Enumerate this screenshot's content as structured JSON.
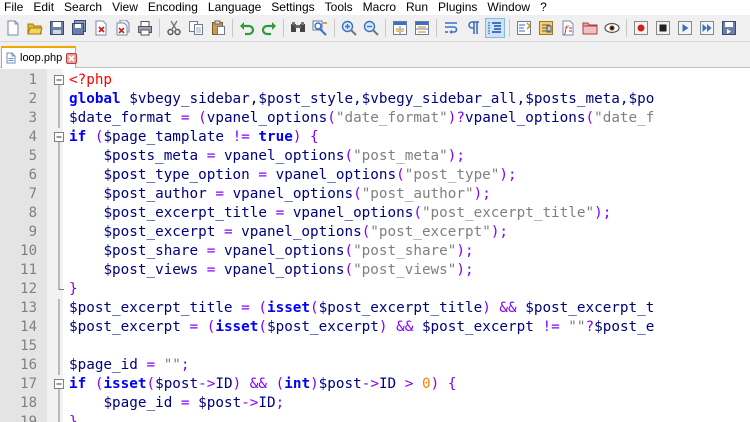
{
  "menu": [
    "File",
    "Edit",
    "Search",
    "View",
    "Encoding",
    "Language",
    "Settings",
    "Tools",
    "Macro",
    "Run",
    "Plugins",
    "Window",
    "?"
  ],
  "toolbar": {
    "groups": [
      [
        "new-file-icon",
        "open-file-icon",
        "save-icon",
        "save-all-icon",
        "close-icon",
        "close-all-icon",
        "print-icon"
      ],
      [
        "cut-icon",
        "copy-icon",
        "paste-icon"
      ],
      [
        "undo-icon",
        "redo-icon"
      ],
      [
        "find-icon",
        "replace-icon"
      ],
      [
        "zoom-in-icon",
        "zoom-out-icon"
      ],
      [
        "sync-vertical-icon",
        "sync-horizontal-icon"
      ],
      [
        "word-wrap-icon",
        "show-all-characters-icon",
        "indent-guide-icon"
      ],
      [
        "define-language-icon",
        "document-map-icon",
        "function-list-icon",
        "folder-workspace-icon",
        "monitoring-icon"
      ],
      [
        "record-macro-icon",
        "stop-recording-icon",
        "playback-macro-icon",
        "run-macro-multiple-icon",
        "save-macro-icon"
      ]
    ],
    "active": "indent-guide-icon",
    "colors": {
      "accent_blue": "#3c6fc4",
      "accent_red": "#cc2222",
      "accent_green": "#2e9a3e",
      "folder": "#e8b830"
    }
  },
  "tab": {
    "label": "loop.php",
    "accent": "#f0a800"
  },
  "editor": {
    "lines": [
      {
        "n": "1",
        "fold": "minus",
        "tokens": [
          [
            "tag",
            "<?php"
          ]
        ]
      },
      {
        "n": "2",
        "fold": "line",
        "tokens": [
          [
            "kw",
            "global"
          ],
          [
            "plain",
            " $vbegy_sidebar,$post_style,$vbegy_sidebar_all,$posts_meta,$po"
          ]
        ]
      },
      {
        "n": "3",
        "fold": "line",
        "tokens": [
          [
            "var",
            "$date_format"
          ],
          [
            "plain",
            " "
          ],
          [
            "op",
            "="
          ],
          [
            "plain",
            " "
          ],
          [
            "op",
            "("
          ],
          [
            "fn",
            "vpanel_options"
          ],
          [
            "op",
            "("
          ],
          [
            "str",
            "\"date_format\""
          ],
          [
            "op",
            ")?"
          ],
          [
            "fn",
            "vpanel_options"
          ],
          [
            "op",
            "("
          ],
          [
            "str",
            "\"date_f"
          ]
        ]
      },
      {
        "n": "4",
        "fold": "minus",
        "tokens": [
          [
            "kw",
            "if"
          ],
          [
            "plain",
            " "
          ],
          [
            "op",
            "("
          ],
          [
            "var",
            "$page_tamplate"
          ],
          [
            "plain",
            " "
          ],
          [
            "op",
            "!="
          ],
          [
            "plain",
            " "
          ],
          [
            "kw",
            "true"
          ],
          [
            "op",
            ")"
          ],
          [
            "plain",
            " "
          ],
          [
            "op",
            "{"
          ]
        ]
      },
      {
        "n": "5",
        "fold": "line",
        "tokens": [
          [
            "plain",
            "    "
          ],
          [
            "var",
            "$posts_meta"
          ],
          [
            "plain",
            " "
          ],
          [
            "op",
            "="
          ],
          [
            "plain",
            " "
          ],
          [
            "fn",
            "vpanel_options"
          ],
          [
            "op",
            "("
          ],
          [
            "str",
            "\"post_meta\""
          ],
          [
            "op",
            ");"
          ]
        ]
      },
      {
        "n": "6",
        "fold": "line",
        "tokens": [
          [
            "plain",
            "    "
          ],
          [
            "var",
            "$post_type_option"
          ],
          [
            "plain",
            " "
          ],
          [
            "op",
            "="
          ],
          [
            "plain",
            " "
          ],
          [
            "fn",
            "vpanel_options"
          ],
          [
            "op",
            "("
          ],
          [
            "str",
            "\"post_type\""
          ],
          [
            "op",
            ");"
          ]
        ]
      },
      {
        "n": "7",
        "fold": "line",
        "tokens": [
          [
            "plain",
            "    "
          ],
          [
            "var",
            "$post_author"
          ],
          [
            "plain",
            " "
          ],
          [
            "op",
            "="
          ],
          [
            "plain",
            " "
          ],
          [
            "fn",
            "vpanel_options"
          ],
          [
            "op",
            "("
          ],
          [
            "str",
            "\"post_author\""
          ],
          [
            "op",
            ");"
          ]
        ]
      },
      {
        "n": "8",
        "fold": "line",
        "tokens": [
          [
            "plain",
            "    "
          ],
          [
            "var",
            "$post_excerpt_title"
          ],
          [
            "plain",
            " "
          ],
          [
            "op",
            "="
          ],
          [
            "plain",
            " "
          ],
          [
            "fn",
            "vpanel_options"
          ],
          [
            "op",
            "("
          ],
          [
            "str",
            "\"post_excerpt_title\""
          ],
          [
            "op",
            ");"
          ]
        ]
      },
      {
        "n": "9",
        "fold": "line",
        "tokens": [
          [
            "plain",
            "    "
          ],
          [
            "var",
            "$post_excerpt"
          ],
          [
            "plain",
            " "
          ],
          [
            "op",
            "="
          ],
          [
            "plain",
            " "
          ],
          [
            "fn",
            "vpanel_options"
          ],
          [
            "op",
            "("
          ],
          [
            "str",
            "\"post_excerpt\""
          ],
          [
            "op",
            ");"
          ]
        ]
      },
      {
        "n": "10",
        "fold": "line",
        "tokens": [
          [
            "plain",
            "    "
          ],
          [
            "var",
            "$post_share"
          ],
          [
            "plain",
            " "
          ],
          [
            "op",
            "="
          ],
          [
            "plain",
            " "
          ],
          [
            "fn",
            "vpanel_options"
          ],
          [
            "op",
            "("
          ],
          [
            "str",
            "\"post_share\""
          ],
          [
            "op",
            ");"
          ]
        ]
      },
      {
        "n": "11",
        "fold": "line",
        "tokens": [
          [
            "plain",
            "    "
          ],
          [
            "var",
            "$post_views"
          ],
          [
            "plain",
            " "
          ],
          [
            "op",
            "="
          ],
          [
            "plain",
            " "
          ],
          [
            "fn",
            "vpanel_options"
          ],
          [
            "op",
            "("
          ],
          [
            "str",
            "\"post_views\""
          ],
          [
            "op",
            ");"
          ]
        ]
      },
      {
        "n": "12",
        "fold": "end",
        "tokens": [
          [
            "op",
            "}"
          ]
        ]
      },
      {
        "n": "13",
        "fold": "line",
        "tokens": [
          [
            "var",
            "$post_excerpt_title"
          ],
          [
            "plain",
            " "
          ],
          [
            "op",
            "="
          ],
          [
            "plain",
            " "
          ],
          [
            "op",
            "("
          ],
          [
            "kw",
            "isset"
          ],
          [
            "op",
            "("
          ],
          [
            "var",
            "$post_excerpt_title"
          ],
          [
            "op",
            ")"
          ],
          [
            "plain",
            " "
          ],
          [
            "op",
            "&&"
          ],
          [
            "plain",
            " "
          ],
          [
            "var",
            "$post_excerpt_t"
          ]
        ]
      },
      {
        "n": "14",
        "fold": "line",
        "tokens": [
          [
            "var",
            "$post_excerpt"
          ],
          [
            "plain",
            " "
          ],
          [
            "op",
            "="
          ],
          [
            "plain",
            " "
          ],
          [
            "op",
            "("
          ],
          [
            "kw",
            "isset"
          ],
          [
            "op",
            "("
          ],
          [
            "var",
            "$post_excerpt"
          ],
          [
            "op",
            ")"
          ],
          [
            "plain",
            " "
          ],
          [
            "op",
            "&&"
          ],
          [
            "plain",
            " "
          ],
          [
            "var",
            "$post_excerpt"
          ],
          [
            "plain",
            " "
          ],
          [
            "op",
            "!="
          ],
          [
            "plain",
            " "
          ],
          [
            "str",
            "\"\""
          ],
          [
            "op",
            "?"
          ],
          [
            "var",
            "$post_e"
          ]
        ]
      },
      {
        "n": "15",
        "fold": "line",
        "tokens": []
      },
      {
        "n": "16",
        "fold": "line",
        "tokens": [
          [
            "var",
            "$page_id"
          ],
          [
            "plain",
            " "
          ],
          [
            "op",
            "="
          ],
          [
            "plain",
            " "
          ],
          [
            "str",
            "\"\""
          ],
          [
            "op",
            ";"
          ]
        ]
      },
      {
        "n": "17",
        "fold": "minus",
        "tokens": [
          [
            "kw",
            "if"
          ],
          [
            "plain",
            " "
          ],
          [
            "op",
            "("
          ],
          [
            "kw",
            "isset"
          ],
          [
            "op",
            "("
          ],
          [
            "var",
            "$post"
          ],
          [
            "op",
            "->"
          ],
          [
            "plain",
            "ID"
          ],
          [
            "op",
            ")"
          ],
          [
            "plain",
            " "
          ],
          [
            "op",
            "&&"
          ],
          [
            "plain",
            " "
          ],
          [
            "op",
            "("
          ],
          [
            "kw",
            "int"
          ],
          [
            "op",
            ")"
          ],
          [
            "var",
            "$post"
          ],
          [
            "op",
            "->"
          ],
          [
            "plain",
            "ID"
          ],
          [
            "plain",
            " "
          ],
          [
            "op",
            ">"
          ],
          [
            "plain",
            " "
          ],
          [
            "num",
            "0"
          ],
          [
            "op",
            ")"
          ],
          [
            "plain",
            " "
          ],
          [
            "op",
            "{"
          ]
        ]
      },
      {
        "n": "18",
        "fold": "line",
        "tokens": [
          [
            "plain",
            "    "
          ],
          [
            "var",
            "$page_id"
          ],
          [
            "plain",
            " "
          ],
          [
            "op",
            "="
          ],
          [
            "plain",
            " "
          ],
          [
            "var",
            "$post"
          ],
          [
            "op",
            "->"
          ],
          [
            "plain",
            "ID"
          ],
          [
            "op",
            ";"
          ]
        ]
      },
      {
        "n": "19",
        "fold": "end",
        "tokens": [
          [
            "op",
            "}"
          ]
        ]
      }
    ]
  }
}
